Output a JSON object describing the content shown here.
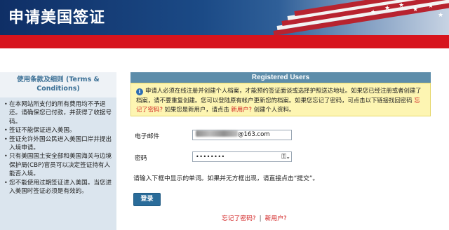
{
  "header": {
    "title": "申请美国签证"
  },
  "left_panel": {
    "title": "使用条款及细则 (Terms & Conditions)",
    "items": [
      "在本网站所支付的所有费用均不予退还。请确保您已付款，并获得了收据号码。",
      "签证不能保证进入美国。",
      "签证允许外国公民进入美国口岸并提出入境申请。",
      "只有美国国土安全部和美国海关与边境保护局(CBP)官员可以决定签证持有人能否入境。",
      "您不能使用过期签证进入美国。当您进入美国时签证必须是有效的。"
    ]
  },
  "registered": {
    "header": "Registered Users",
    "notice_part1": "申请人必须在线注册并创建个人档案，才能预约签证面谈或选择护照送达地址。如果您已经注册或者创建了档案，请不要重复创建。您可以登陆原有帐户更新您的档案。如果您忘记了密码，可点击以下链接找回密码",
    "notice_forgot_link": "忘记了密码?",
    "notice_part2": "如果您是新用户，请点击",
    "notice_new_link": "新用户?",
    "notice_part3": "创建个人资料。",
    "email_label": "电子邮件",
    "email_suffix": "@163.com",
    "password_label": "密码",
    "password_value": "••••••••",
    "hint": "请输入下框中显示的单词。如果并无方框出现，请直接点击“提交”。",
    "login_button": "登录",
    "forgot_link": "忘记了密码?",
    "separator": "|",
    "new_user_link": "新用户?"
  },
  "icons": {
    "info": "info-icon",
    "key": "key-icon",
    "dropdown": "chevron-down-icon"
  },
  "colors": {
    "header_blue": "#1b4a86",
    "red_bar": "#d7141d",
    "section_header": "#5d8daa",
    "notice_bg": "#fdf5b2",
    "link_red": "#d11f1f",
    "button_blue": "#2a6c9a"
  }
}
